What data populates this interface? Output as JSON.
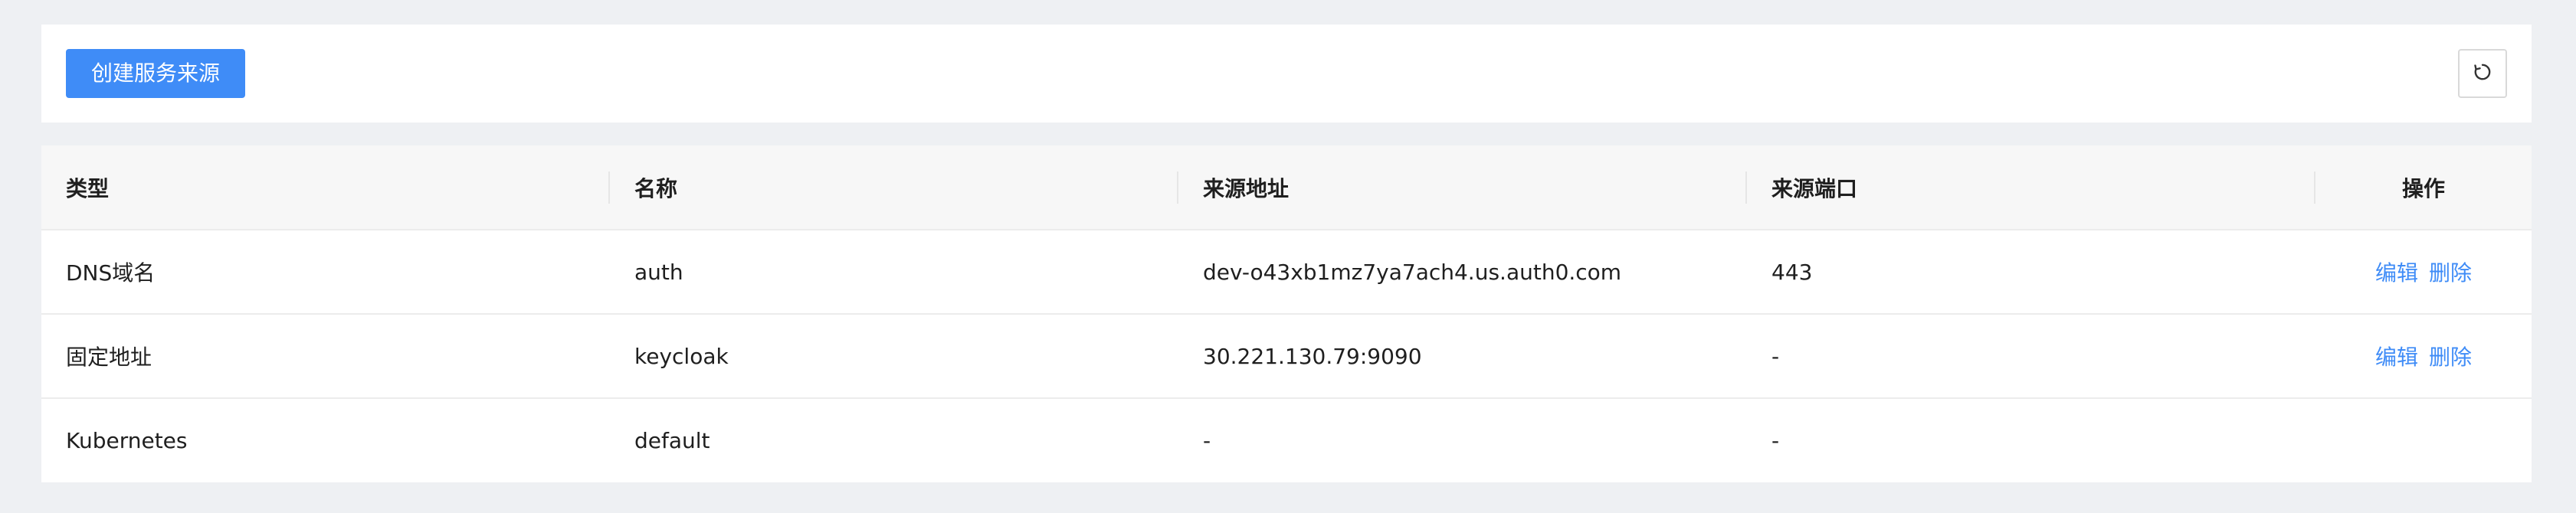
{
  "toolbar": {
    "create_label": "创建服务来源",
    "refresh_icon": "refresh-icon"
  },
  "table": {
    "columns": [
      "类型",
      "名称",
      "来源地址",
      "来源端口",
      "操作"
    ],
    "rows": [
      {
        "type": "DNS域名",
        "name": "auth",
        "address": "dev-o43xb1mz7ya7ach4.us.auth0.com",
        "port": "443",
        "edit": "编辑",
        "delete": "删除"
      },
      {
        "type": "固定地址",
        "name": "keycloak",
        "address": "30.221.130.79:9090",
        "port": "-",
        "edit": "编辑",
        "delete": "删除"
      },
      {
        "type": "Kubernetes",
        "name": "default",
        "address": "-",
        "port": "-"
      }
    ]
  },
  "colors": {
    "primary": "#3f8cf7",
    "background": "#eef0f3",
    "header_bg": "#f7f7f7"
  }
}
